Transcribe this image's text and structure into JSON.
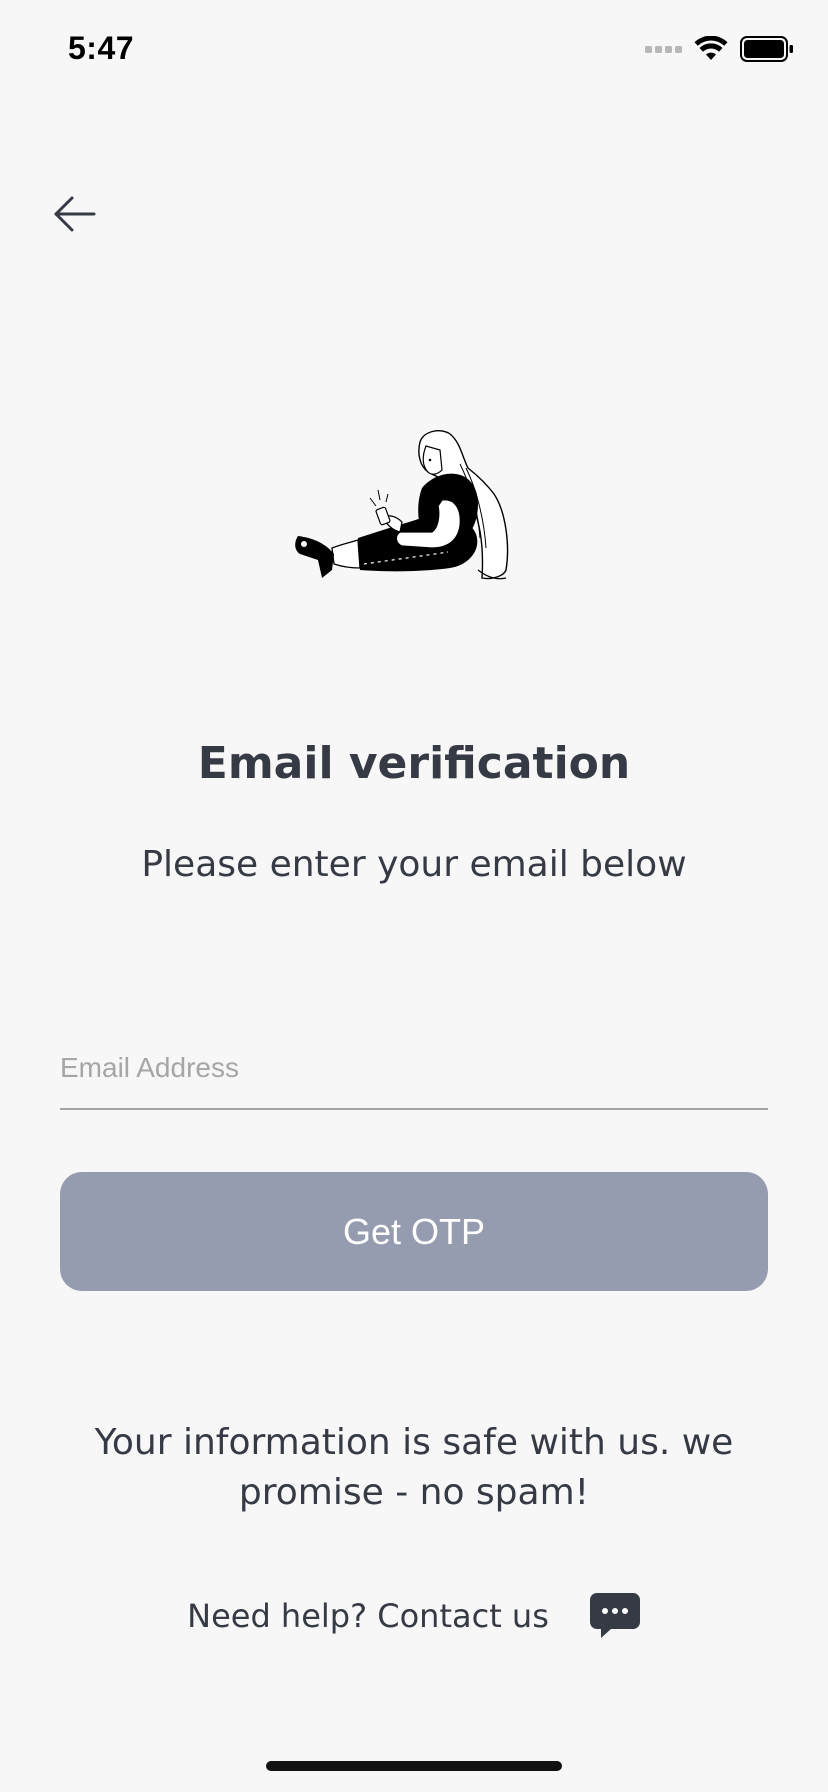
{
  "status_bar": {
    "time": "5:47"
  },
  "heading": {
    "title": "Email verification",
    "subtitle": "Please enter your email below"
  },
  "form": {
    "email_placeholder": "Email Address",
    "email_value": "",
    "submit_label": "Get OTP",
    "submit_color": "#959caf"
  },
  "footer": {
    "safety_note": "Your information is safe with us. we promise - no spam!",
    "help_label": "Need help? Contact us"
  },
  "icons": {
    "back": "arrow-left-icon",
    "chat": "chat-bubble-icon"
  }
}
